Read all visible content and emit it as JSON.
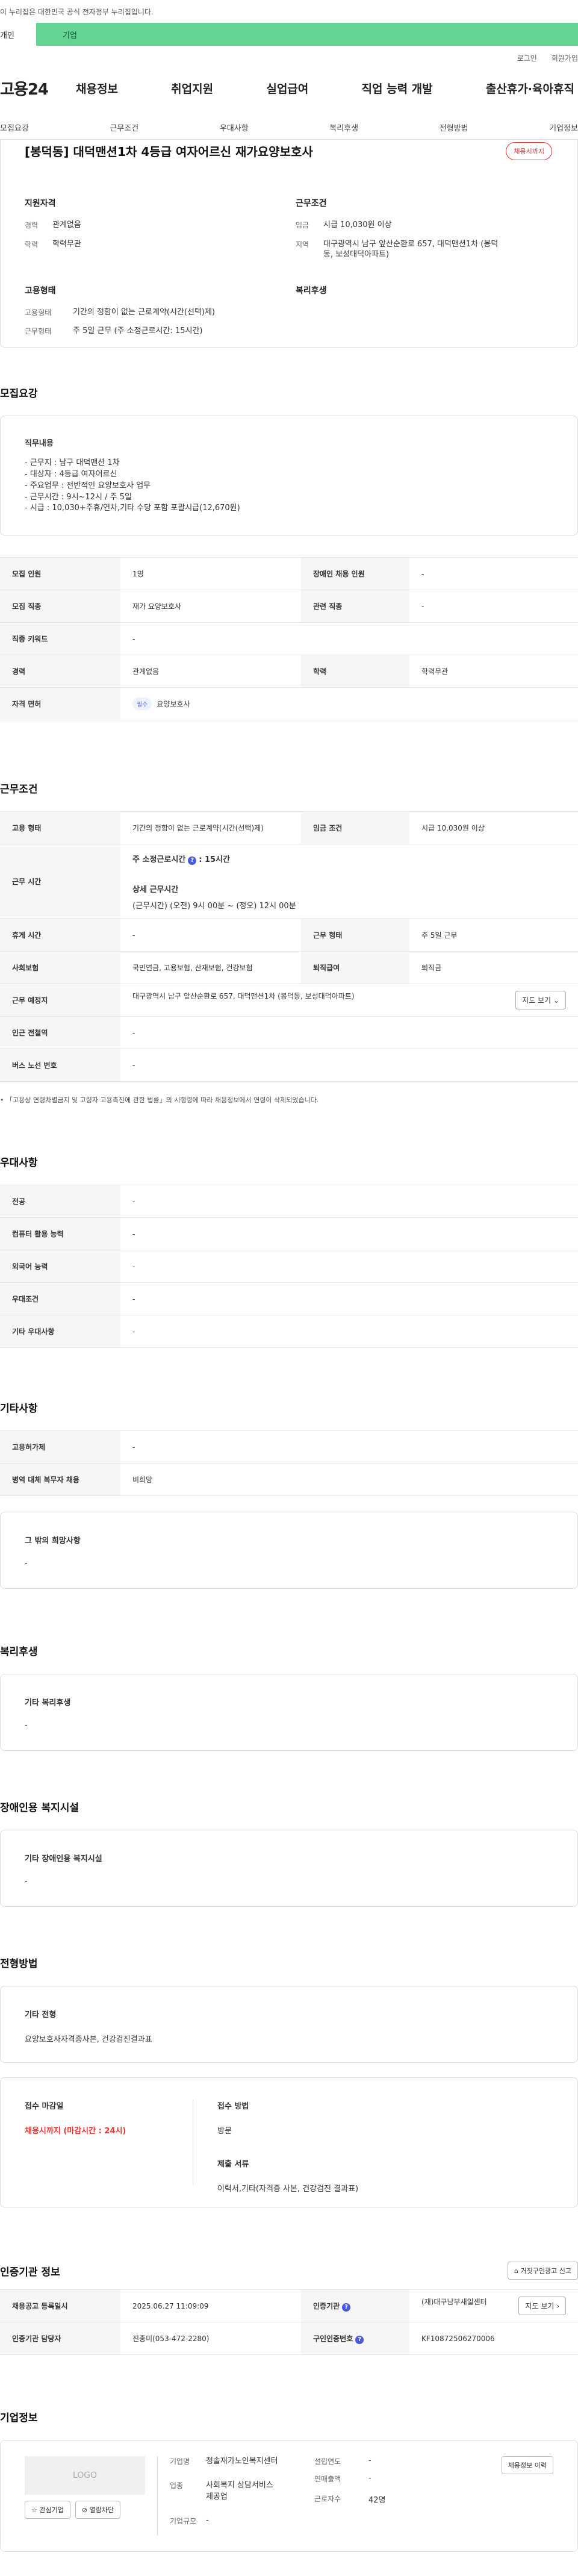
{
  "gov": {
    "text": "이 누리집은 대한민국 공식 전자정부 누리집입니다."
  },
  "tabs": {
    "personal": "개인",
    "company": "기업"
  },
  "util": {
    "login": "로그인",
    "join": "회원가입"
  },
  "gnb": {
    "logo": "고용24",
    "menu": [
      "채용정보",
      "취업지원",
      "실업급여",
      "직업 능력 개발",
      "출산휴가·육아휴직"
    ]
  },
  "subnav": [
    "모집요강",
    "근무조건",
    "우대사항",
    "복리후생",
    "전형방법",
    "기업정보"
  ],
  "header": {
    "title": "[봉덕동] 대덕맨션1차 4등급 여자어르신 재가요양보호사",
    "badge": "채용시까지",
    "qual_title": "지원자격",
    "cond_title": "근무조건",
    "type_title": "고용형태",
    "welfare_title": "복리후생",
    "qual": [
      {
        "k": "경력",
        "v": "관계없음"
      },
      {
        "k": "학력",
        "v": "학력무관"
      }
    ],
    "cond": [
      {
        "k": "임금",
        "v": "시급 10,030원 이상"
      },
      {
        "k": "지역",
        "v": "대구광역시 남구 앞산순환로 657, 대덕맨션1차 (봉덕동, 보성대덕아파트)"
      }
    ],
    "type": [
      {
        "k": "고용형태",
        "v": "기간의 정함이 없는 근로계약(시간(선택)제)"
      },
      {
        "k": "근무형태",
        "v": "주 5일 근무 (주 소정근로시간: 15시간)"
      }
    ]
  },
  "recruit": {
    "title": "모집요강",
    "duty_title": "직무내용",
    "duty_text": "- 근무지 : 남구 대덕맨션 1차\n- 대상자 : 4등급 여자어르신\n- 주요업무 : 전반적인 요양보호사 업무\n- 근무시간 : 9시~12시 / 주 5일\n- 시급 : 10,030+주휴/연차,기타 수당 포함 포괄시급(12,670원)",
    "rows": [
      [
        "모집 인원",
        "1명",
        "장애인 채용 인원",
        "-"
      ],
      [
        "모집 직종",
        "재가 요양보호사",
        "관련 직종",
        "-"
      ],
      [
        "직종 키워드",
        "-"
      ],
      [
        "경력",
        "관계없음",
        "학력",
        "학력무관"
      ]
    ],
    "license_label": "자격 면허",
    "license_badge": "필수",
    "license_value": "요양보호사"
  },
  "work": {
    "title": "근무조건",
    "type_label": "고용 형태",
    "type_value": "기간의 정함이 없는 근로계약(시간(선택)제)",
    "wage_label": "임금 조건",
    "wage_value": "시급 10,030원 이상",
    "hours_label": "근무 시간",
    "hours_main": "주 소정근로시간",
    "hours_value": ": 15시간",
    "hours_detail_title": "상세 근무시간",
    "hours_detail": "(근무시간) (오전) 9시 00분 ~ (정오) 12시 00분",
    "rest_label": "휴게 시간",
    "rest_value": "-",
    "form_label": "근무 형태",
    "form_value": "주 5일 근무",
    "ins_label": "사회보험",
    "ins_value": "국민연금, 고용보험, 산재보험, 건강보험",
    "sev_label": "퇴직급여",
    "sev_value": "퇴직금",
    "place_label": "근무 예정지",
    "place_value": "대구광역시 남구 앞산순환로 657, 대덕맨션1차 (봉덕동, 보성대덕아파트)",
    "map_button": "지도 보기",
    "station_label": "인근 전철역",
    "station_value": "-",
    "bus_label": "버스 노선 번호",
    "bus_value": "-",
    "note": "「고용상 연령차별금지 및 고령자 고용촉진에 관한 법률」의 시행령에 따라 채용정보에서 연령이 삭제되었습니다."
  },
  "pref": {
    "title": "우대사항",
    "rows": [
      [
        "전공",
        "-"
      ],
      [
        "컴퓨터 활용 능력",
        "-"
      ],
      [
        "외국어 능력",
        "-"
      ],
      [
        "우대조건",
        "-"
      ],
      [
        "기타 우대사항",
        "-"
      ]
    ]
  },
  "etc": {
    "title": "기타사항",
    "rows": [
      [
        "고용허가제",
        "-"
      ],
      [
        "병역 대체 복무자 채용",
        "비희망"
      ]
    ],
    "other_title": "그 밖의 희망사항",
    "other_value": "-"
  },
  "welfare": {
    "title": "복리후생",
    "box_title": "기타 복리후생",
    "value": "-"
  },
  "disabled": {
    "title": "장애인용 복지시설",
    "box_title": "기타 장애인용 복지시설",
    "value": "-"
  },
  "process": {
    "title": "전형방법",
    "box_title": "기타 전형",
    "box_value": "요양보호사자격증사본, 건강검진결과표",
    "deadline_title": "접수 마감일",
    "deadline_value": "채용시까지 (마감시간 : 24시)",
    "method_title": "접수 방법",
    "method_value": "방문",
    "docs_title": "제출 서류",
    "docs_value": "이력서,기타(자격증 사본, 건강검진 결과표)"
  },
  "agency": {
    "title": "인증기관 정보",
    "report_button": "거짓구인광고 신고",
    "reg_label": "채용공고 등록일시",
    "reg_value": "2025.06.27 11:09:09",
    "org_label": "인증기관",
    "org_value": "(재)대구남부새일센터",
    "map_button": "지도 보기",
    "staff_label": "인증기관 담당자",
    "staff_value": "진종미(053-472-2280)",
    "cert_label": "구인인증번호",
    "cert_value": "KF10872506270006"
  },
  "company": {
    "title": "기업정보",
    "logo": "LOGO",
    "fav_button": "관심기업",
    "block_button": "열람차단",
    "name_label": "기업명",
    "name_value": "청솔재가노인복지센터",
    "founded_label": "설립연도",
    "founded_value": "-",
    "sales_label": "연매출액",
    "sales_value": "-",
    "industry_label": "업종",
    "industry_value": "사회복지 상담서비스 제공업",
    "employees_label": "근로자수",
    "employees_value": "42명",
    "size_label": "기업규모",
    "size_value": "-",
    "history_button": "채용정보 이력"
  }
}
